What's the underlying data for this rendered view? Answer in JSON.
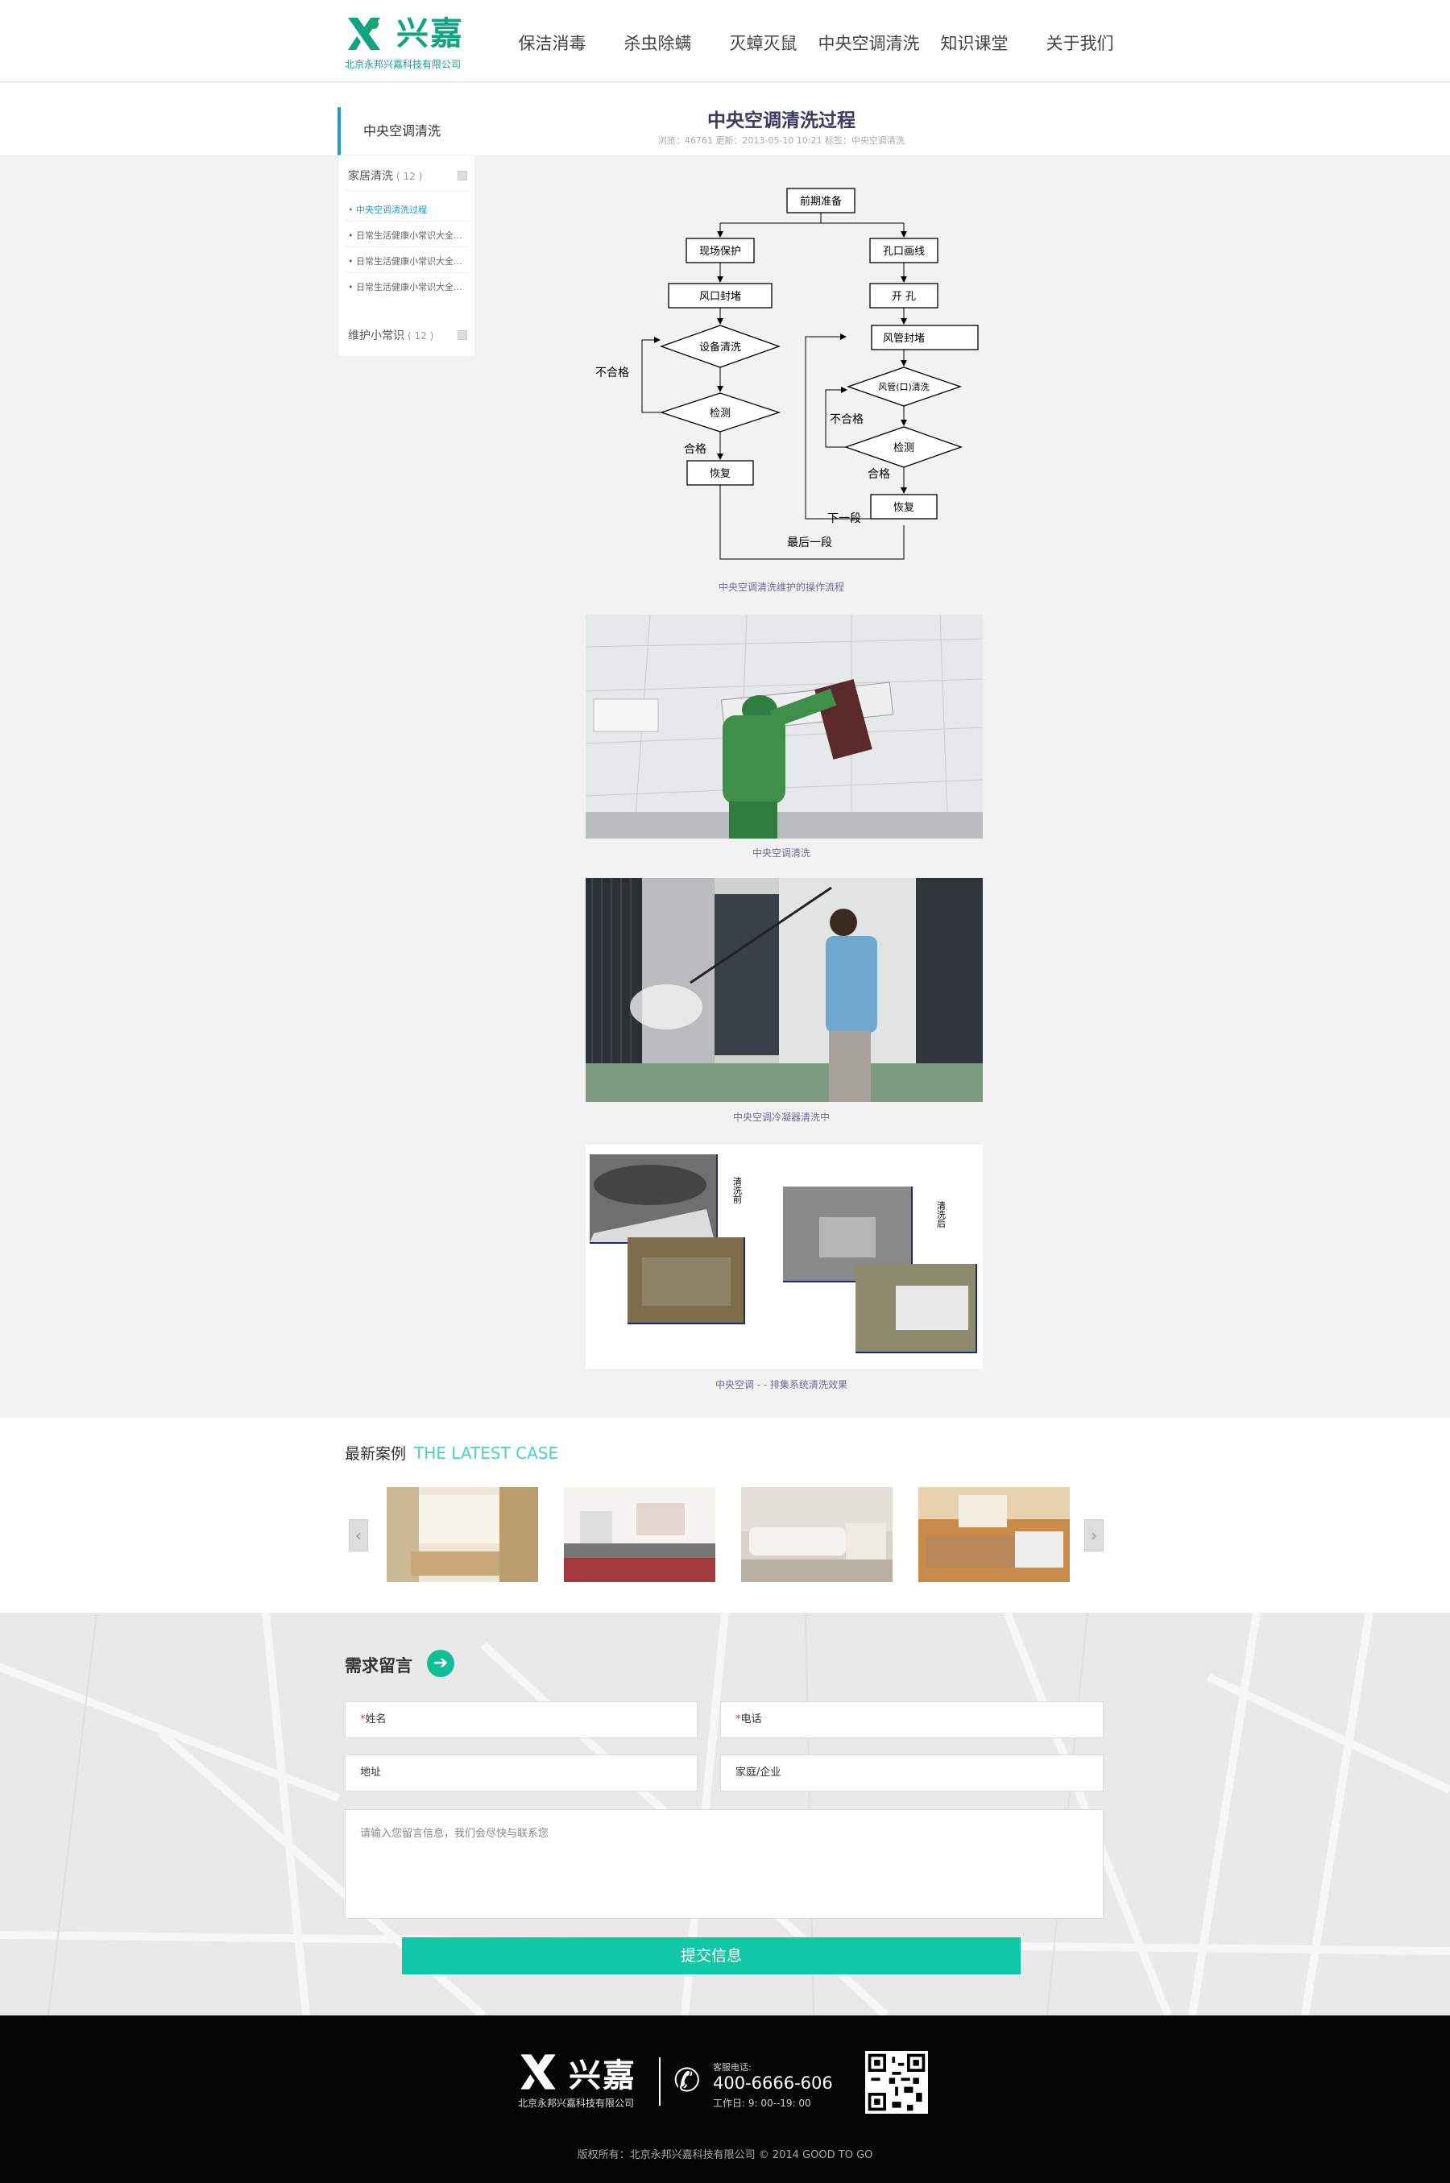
{
  "header": {
    "logo_text": "兴嘉",
    "logo_sub": "北京永邦兴嘉科技有限公司",
    "nav": [
      "保洁消毒",
      "杀虫除螨",
      "灭蟑灭鼠",
      "中央空调清洗",
      "知识课堂",
      "关于我们"
    ]
  },
  "sidebar": {
    "heading": "中央空调清洗",
    "cat1": {
      "label": "家居清洗",
      "count": "( 12 )"
    },
    "links": [
      "• 中央空调清洗过程",
      "• 日常生活健康小常识大全...",
      "• 日常生活健康小常识大全...",
      "• 日常生活健康小常识大全..."
    ],
    "cat2": {
      "label": "维护小常识",
      "count": "( 12 )"
    }
  },
  "article": {
    "title": "中央空调清洗过程",
    "meta": "浏览：46761    更新：2013-05-10 10:21    标签：中央空调清洗",
    "flow": {
      "start": "前期准备",
      "left": [
        "现场保护",
        "风口封堵",
        "设备清洗",
        "检测",
        "恢复"
      ],
      "right": [
        "孔口画线",
        "开 孔",
        "风管封堵",
        "风管(口)清洗",
        "检测",
        "恢复"
      ],
      "labels": {
        "fail_left": "不合格",
        "pass_left": "合格",
        "fail_right": "不合格",
        "pass_right": "合格",
        "next": "下一段",
        "last": "最后一段"
      }
    },
    "captions": [
      "中央空调清洗维护的操作流程",
      "中央空调清洗",
      "中央空调冷凝器清洗中",
      "中央空调 - - 排集系统清洗效果"
    ],
    "compare": {
      "before": "清洗前",
      "after": "清洗后"
    }
  },
  "cases": {
    "title": "最新案例",
    "title_en": "THE LATEST CASE",
    "prev": "‹",
    "next": "›"
  },
  "message": {
    "title": "需求留言",
    "arrow": "➔",
    "fields": {
      "name": "姓名",
      "phone": "电话",
      "address": "地址",
      "type": "家庭/企业"
    },
    "required_mark": "*",
    "textarea_placeholder": "请输入您留言信息，我们会尽快与联系您",
    "submit": "提交信息"
  },
  "footer": {
    "logo_text": "兴嘉",
    "logo_sub": "北京永邦兴嘉科技有限公司",
    "tel_label": "客服电话:",
    "tel": "400-6666-606",
    "hours": "工作日: 9: 00--19: 00",
    "copyright": "版权所有：北京永邦兴嘉科技有限公司 © 2014 GOOD TO GO"
  },
  "colors": {
    "brand": "#12a385",
    "accent_blue": "#1d9bd6",
    "submit": "#10c8a8",
    "footer_bg": "#050505"
  }
}
